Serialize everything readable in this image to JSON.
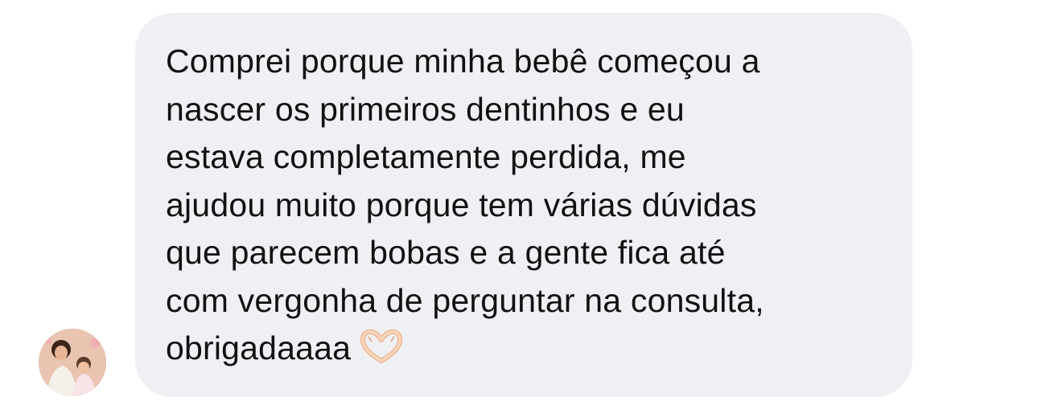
{
  "message": {
    "text": "Comprei porque minha bebê começou a\nnascer os primeiros dentinhos e eu\nestava completamente perdida, me\najudou muito porque tem várias dúvidas\nque parecem bobas e a gente fica até\ncom vergonha de perguntar na consulta,\nobrigadaaaa",
    "emoji": "heart-hands-icon"
  },
  "colors": {
    "bubble_bg": "#eff0f4",
    "text": "#111111",
    "emoji_skin": "#f6c9a8"
  }
}
